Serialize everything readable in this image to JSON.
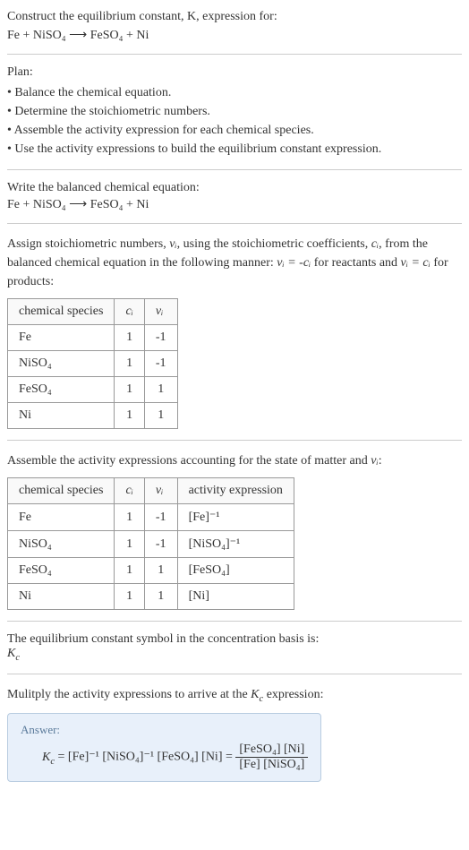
{
  "header": {
    "construct_line": "Construct the equilibrium constant, K, expression for:",
    "equation": "Fe + NiSO₄ ⟶ FeSO₄ + Ni"
  },
  "plan": {
    "title": "Plan:",
    "items": [
      "Balance the chemical equation.",
      "Determine the stoichiometric numbers.",
      "Assemble the activity expression for each chemical species.",
      "Use the activity expressions to build the equilibrium constant expression."
    ]
  },
  "balanced": {
    "title": "Write the balanced chemical equation:",
    "equation": "Fe + NiSO₄ ⟶ FeSO₄ + Ni"
  },
  "stoich": {
    "intro_part1": "Assign stoichiometric numbers, ",
    "nu_i": "νᵢ",
    "intro_part2": ", using the stoichiometric coefficients, ",
    "c_i": "cᵢ",
    "intro_part3": ", from the balanced chemical equation in the following manner: ",
    "rule1": "νᵢ = -cᵢ",
    "intro_part4": " for reactants and ",
    "rule2": "νᵢ = cᵢ",
    "intro_part5": " for products:",
    "headers": {
      "species": "chemical species",
      "ci": "cᵢ",
      "nui": "νᵢ"
    },
    "rows": [
      {
        "species": "Fe",
        "ci": "1",
        "nui": "-1"
      },
      {
        "species": "NiSO₄",
        "ci": "1",
        "nui": "-1"
      },
      {
        "species": "FeSO₄",
        "ci": "1",
        "nui": "1"
      },
      {
        "species": "Ni",
        "ci": "1",
        "nui": "1"
      }
    ]
  },
  "activity": {
    "intro_part1": "Assemble the activity expressions accounting for the state of matter and ",
    "nu_i": "νᵢ",
    "intro_part2": ":",
    "headers": {
      "species": "chemical species",
      "ci": "cᵢ",
      "nui": "νᵢ",
      "expr": "activity expression"
    },
    "rows": [
      {
        "species": "Fe",
        "ci": "1",
        "nui": "-1",
        "expr": "[Fe]⁻¹"
      },
      {
        "species": "NiSO₄",
        "ci": "1",
        "nui": "-1",
        "expr": "[NiSO₄]⁻¹"
      },
      {
        "species": "FeSO₄",
        "ci": "1",
        "nui": "1",
        "expr": "[FeSO₄]"
      },
      {
        "species": "Ni",
        "ci": "1",
        "nui": "1",
        "expr": "[Ni]"
      }
    ]
  },
  "symbol": {
    "line": "The equilibrium constant symbol in the concentration basis is:",
    "kc": "K_c"
  },
  "multiply": {
    "line_part1": "Mulitply the activity expressions to arrive at the ",
    "kc": "K_c",
    "line_part2": " expression:"
  },
  "answer": {
    "label": "Answer:",
    "kc": "K_c",
    "eq": " = ",
    "term1": "[Fe]⁻¹",
    "term2": "[NiSO₄]⁻¹",
    "term3": "[FeSO₄]",
    "term4": "[Ni]",
    "eq2": " = ",
    "frac_num": "[FeSO₄] [Ni]",
    "frac_den": "[Fe] [NiSO₄]"
  }
}
